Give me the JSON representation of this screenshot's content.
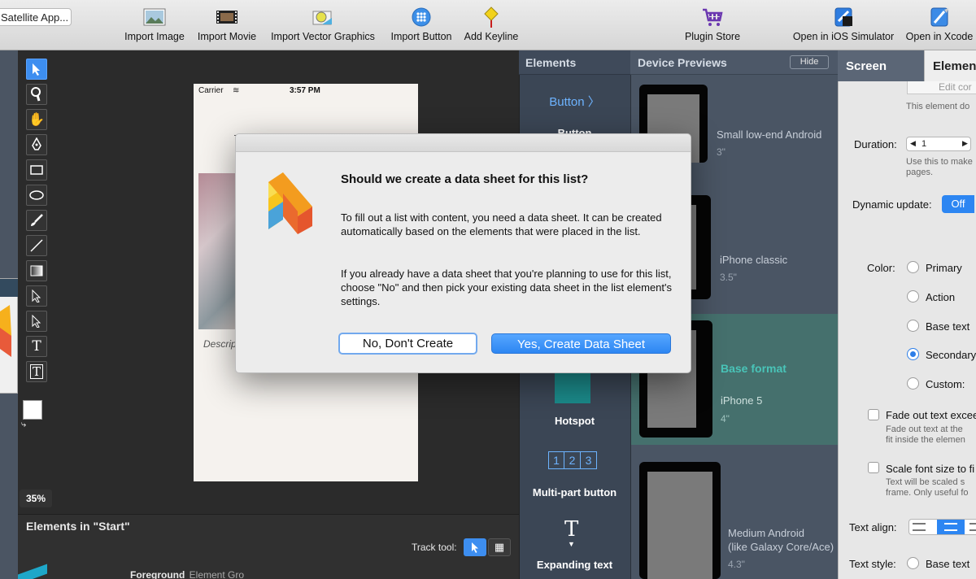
{
  "toolbar": {
    "app_field": "Satellite App...",
    "items": [
      {
        "label": "Import Image",
        "icon": "image-icon"
      },
      {
        "label": "Import Movie",
        "icon": "film-icon"
      },
      {
        "label": "Import Vector Graphics",
        "icon": "vector-icon"
      },
      {
        "label": "Import Button",
        "icon": "button-icon"
      },
      {
        "label": "Add Keyline",
        "icon": "keyline-icon"
      },
      {
        "label": "Plugin Store",
        "icon": "cart-icon"
      },
      {
        "label": "Open in iOS Simulator",
        "icon": "simulator-icon"
      },
      {
        "label": "Open in Xcode",
        "icon": "xcode-icon"
      }
    ]
  },
  "canvas": {
    "carrier": "Carrier",
    "time": "3:57 PM",
    "description_snippet": "Descrip",
    "zoom": "35%"
  },
  "elements_in_start": {
    "title": "Elements in \"Start\"",
    "track_tool_label": "Track tool:",
    "row_name": "Foreground",
    "row_type": "Element Gro"
  },
  "elements_panel": {
    "title": "Elements",
    "items": [
      "Button",
      "Button",
      "Hotspot",
      "Multi-part button",
      "Expanding text"
    ],
    "button_preview": "Button",
    "multipart_digits": [
      "1",
      "2",
      "3"
    ]
  },
  "device_previews": {
    "title": "Device Previews",
    "hide_label": "Hide",
    "selected_label": "Base format",
    "devices": [
      {
        "name": "Small low-end Android",
        "size": "3\""
      },
      {
        "name": "iPhone classic",
        "size": "3.5\""
      },
      {
        "name": "iPhone 5",
        "size": "4\""
      },
      {
        "name": "Medium Android",
        "name2": "(like Galaxy Core/Ace)",
        "size": "4.3\""
      }
    ]
  },
  "inspector": {
    "tab_screen": "Screen",
    "tab_elements": "Elements",
    "edit_button": "Edit cor",
    "element_note": "This element do",
    "duration_label": "Duration:",
    "duration_value": "1",
    "duration_note1": "Use this to make",
    "duration_note2": "pages.",
    "dynamic_label": "Dynamic update:",
    "dynamic_value": "Off",
    "color_label": "Color:",
    "colors": [
      "Primary",
      "Action",
      "Base text",
      "Secondary",
      "Custom:"
    ],
    "fade_label": "Fade out text excee",
    "fade_note1": "Fade out text at the",
    "fade_note2": "fit inside the elemen",
    "scale_label": "Scale font size to fi",
    "scale_note1": "Text will be scaled s",
    "scale_note2": "frame. Only useful fo",
    "align_label": "Text align:",
    "style_label": "Text style:",
    "style_value": "Base text"
  },
  "dialog": {
    "title": "Should we create a data sheet for this list?",
    "para1": "To fill out a list with content, you need a data sheet. It can be created automatically based on the elements that were placed in the list.",
    "para2": "If you already have a data sheet that you're planning to use for this list, choose \"No\" and then pick your existing data sheet in the list element's settings.",
    "no_label": "No, Don't Create",
    "yes_label": "Yes, Create Data Sheet"
  },
  "colors": {
    "accent": "#3d8ef0",
    "teal": "#49c4b8"
  }
}
